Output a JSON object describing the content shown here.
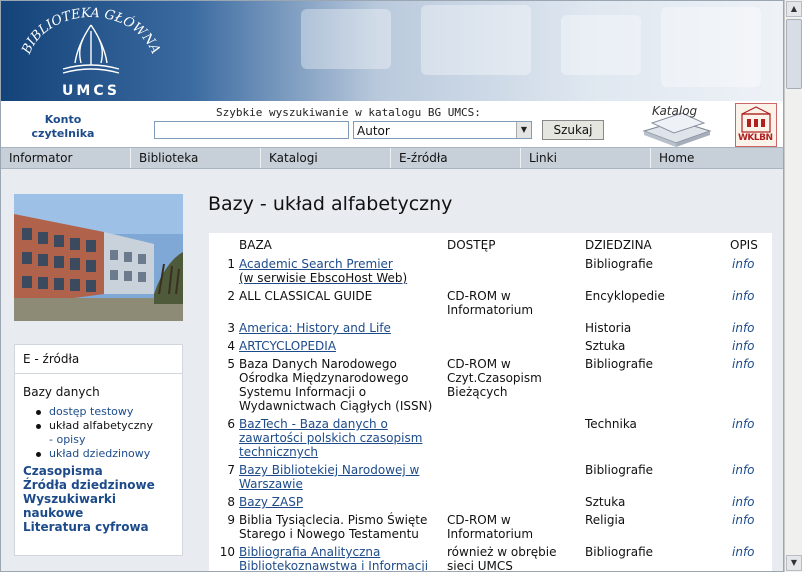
{
  "header": {
    "logo_top_text": "BIBLIOTEKA GŁÓWNA",
    "logo_bottom_text": "UMCS"
  },
  "search": {
    "konto_line1": "Konto",
    "konto_line2": "czytelnika",
    "label": "Szybkie wyszukiwanie w katalogu BG UMCS:",
    "input_value": "",
    "select_value": "Autor",
    "button_label": "Szukaj",
    "katalog_logo_text": "Katalog",
    "wklbn_logo_text": "WKLBN"
  },
  "nav": {
    "items": [
      "Informator",
      "Biblioteka",
      "Katalogi",
      "E-źródła",
      "Linki",
      "Home"
    ]
  },
  "sidebar": {
    "header": "E - źródła",
    "bazy_title": "Bazy danych",
    "bazy_items": [
      "dostęp testowy",
      "układ alfabetyczny",
      "- opisy",
      "układ dziedzinowy"
    ],
    "sections": [
      "Czasopisma",
      "Źródła dziedzinowe",
      "Wyszukiwarki",
      "naukowe",
      "Literatura cyfrowa"
    ]
  },
  "main": {
    "title": "Bazy - układ alfabetyczny",
    "columns": [
      "BAZA",
      "DOSTĘP",
      "DZIEDZINA",
      "OPIS"
    ],
    "rows": [
      {
        "num": "1",
        "baza": "Academic Search Premier",
        "baza_sub": "(w serwisie EbscoHost Web)",
        "dostep": "",
        "dziedzina": "Bibliografie",
        "opis": "info"
      },
      {
        "num": "2",
        "baza": "ALL CLASSICAL GUIDE",
        "baza_sub": "",
        "dostep": "CD-ROM w Informatorium",
        "dziedzina": "Encyklopedie",
        "opis": "info"
      },
      {
        "num": "3",
        "baza": "America: History and Life",
        "baza_sub": "",
        "dostep": "",
        "dziedzina": "Historia",
        "opis": "info"
      },
      {
        "num": "4",
        "baza": "ARTCYCLOPEDIA",
        "baza_sub": "",
        "dostep": "",
        "dziedzina": "Sztuka",
        "opis": "info"
      },
      {
        "num": "5",
        "baza": "Baza Danych Narodowego Ośrodka Międzynarodowego Systemu Informacji o Wydawnictwach Ciągłych (ISSN)",
        "baza_sub": "",
        "dostep": "CD-ROM w Czyt.Czasopism Bieżących",
        "dziedzina": "Bibliografie",
        "opis": "info"
      },
      {
        "num": "6",
        "baza": "BazTech - Baza danych o zawartości polskich czasopism technicznych",
        "baza_sub": "",
        "dostep": "",
        "dziedzina": "Technika",
        "opis": "info"
      },
      {
        "num": "7",
        "baza": "Bazy Bibliotekiej Narodowej w Warszawie",
        "baza_sub": "",
        "dostep": "",
        "dziedzina": "Bibliografie",
        "opis": "info"
      },
      {
        "num": "8",
        "baza": "Bazy ZASP",
        "baza_sub": "",
        "dostep": "",
        "dziedzina": "Sztuka",
        "opis": "info"
      },
      {
        "num": "9",
        "baza": "Biblia Tysiąclecia. Pismo Święte Starego i Nowego Testamentu",
        "baza_sub": "",
        "dostep": "CD-ROM w Informatorium",
        "dziedzina": "Religia",
        "opis": "info"
      },
      {
        "num": "10",
        "baza": "Bibliografia Analityczna Bibliotekoznawstwa i Informacji",
        "baza_sub": "",
        "dostep": "również w obrębie sieci UMCS",
        "dziedzina": "Bibliografie",
        "opis": "info"
      }
    ]
  }
}
